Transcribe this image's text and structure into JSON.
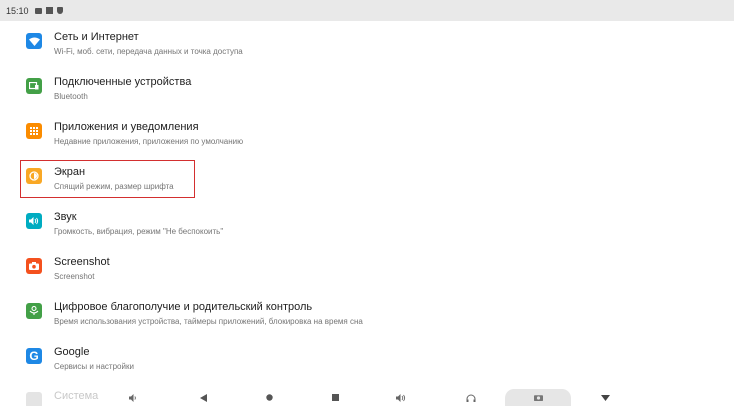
{
  "status_bar": {
    "time": "15:10"
  },
  "settings": {
    "items": [
      {
        "title": "Сеть и Интернет",
        "subtitle": "Wi-Fi, моб. сети, передача данных и точка доступа",
        "icon": "wifi-icon",
        "color": "#1e88e5"
      },
      {
        "title": "Подключенные устройства",
        "subtitle": "Bluetooth",
        "icon": "devices-icon",
        "color": "#43a047"
      },
      {
        "title": "Приложения и уведомления",
        "subtitle": "Недавние приложения, приложения по умолчанию",
        "icon": "apps-icon",
        "color": "#fb8c00"
      },
      {
        "title": "Экран",
        "subtitle": "Спящий режим, размер шрифта",
        "icon": "brightness-icon",
        "color": "#f9a825"
      },
      {
        "title": "Звук",
        "subtitle": "Громкость, вибрация, режим \"Не беспокоить\"",
        "icon": "volume-icon",
        "color": "#00acc1"
      },
      {
        "title": "Screenshot",
        "subtitle": "Screenshot",
        "icon": "camera-icon",
        "color": "#f4511e"
      },
      {
        "title": "Цифровое благополучие и родительский контроль",
        "subtitle": "Время использования устройства, таймеры приложений, блокировка на время сна",
        "icon": "wellbeing-icon",
        "color": "#43a047"
      },
      {
        "title": "Google",
        "subtitle": "Сервисы и настройки",
        "icon": "google-icon",
        "color": "#1e88e5"
      }
    ],
    "partial_item": {
      "title": "Система"
    }
  },
  "nav_bar": {
    "buttons": [
      "volume-down-icon",
      "back-icon",
      "home-icon",
      "recents-icon",
      "volume-up-icon",
      "headphones-icon",
      "screenshot-icon",
      "hide-nav-icon"
    ],
    "active": "screenshot-icon"
  },
  "highlight": {
    "target": "Экран",
    "color": "#d32f2f"
  }
}
